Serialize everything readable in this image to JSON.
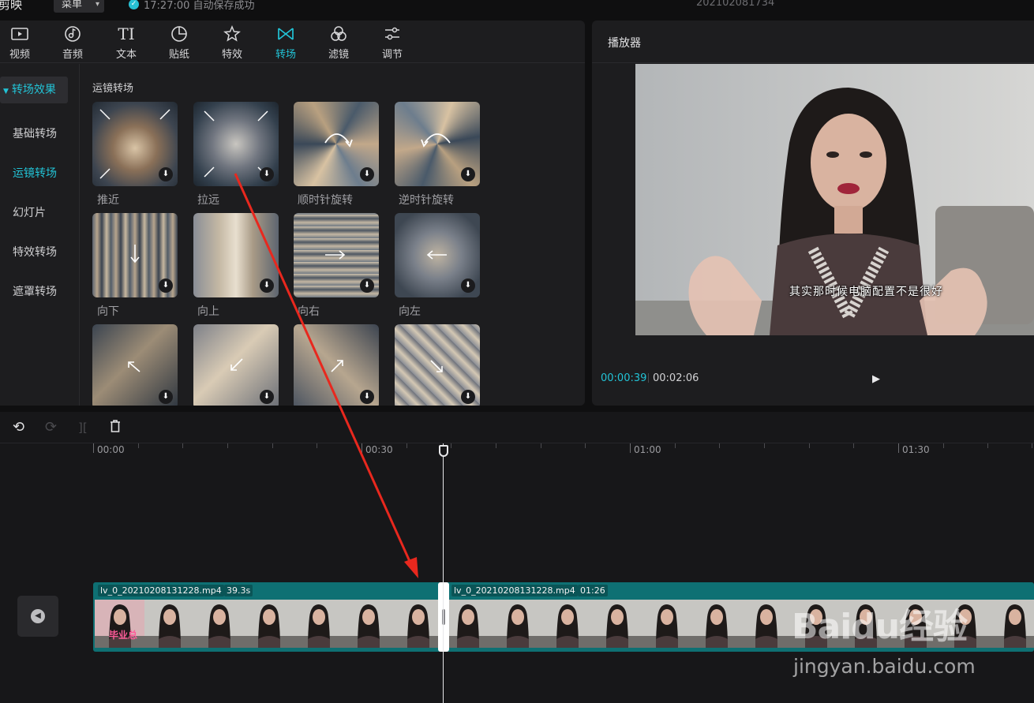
{
  "titlebar": {
    "app_name": "剪映",
    "menu_label": "菜单",
    "save_status": "17:27:00 自动保存成功",
    "project_name": "202102081734"
  },
  "toolbar": {
    "items": [
      {
        "label": "视频",
        "icon": "video-icon"
      },
      {
        "label": "音频",
        "icon": "audio-icon"
      },
      {
        "label": "文本",
        "icon": "text-icon"
      },
      {
        "label": "贴纸",
        "icon": "sticker-icon"
      },
      {
        "label": "特效",
        "icon": "effects-icon"
      },
      {
        "label": "转场",
        "icon": "transition-icon",
        "active": true
      },
      {
        "label": "滤镜",
        "icon": "filter-icon"
      },
      {
        "label": "调节",
        "icon": "adjust-icon"
      }
    ]
  },
  "sidebar": {
    "header": "转场效果",
    "items": [
      "基础转场",
      "运镜转场",
      "幻灯片",
      "特效转场",
      "遮罩转场"
    ],
    "active_item": "运镜转场"
  },
  "gallery": {
    "section_title": "运镜转场",
    "items": [
      "推近",
      "拉远",
      "顺时针旋转",
      "逆时针旋转",
      "向下",
      "向上",
      "向右",
      "向左"
    ]
  },
  "player": {
    "title": "播放器",
    "subtitle": "其实那时候电脑配置不是很好",
    "current_time": "00:00:39",
    "total_time": "00:02:06"
  },
  "timeline": {
    "ruler_labels": [
      "00:00",
      "00:30",
      "01:00",
      "01:30"
    ],
    "clips": [
      {
        "name": "lv_0_20210208131228.mp4",
        "duration": "39.3s"
      },
      {
        "name": "lv_0_20210208131228.mp4",
        "duration": "01:26"
      }
    ],
    "first_frame_text": [
      "毕业总"
    ]
  },
  "watermark": {
    "logo": "Baidu经验",
    "url": "jingyan.baidu.com"
  },
  "colors": {
    "accent": "#22c3d6",
    "track": "#0e7073",
    "annotation_arrow": "#e8281e"
  }
}
